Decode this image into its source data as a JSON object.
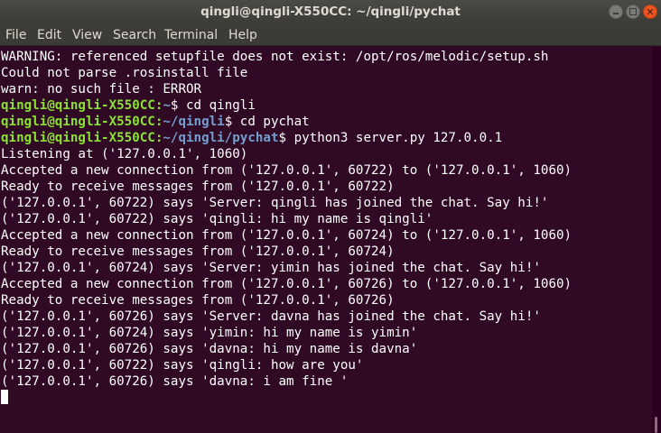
{
  "window": {
    "title": "qingli@qingli-X550CC: ~/qingli/pychat"
  },
  "menu": {
    "items": [
      "File",
      "Edit",
      "View",
      "Search",
      "Terminal",
      "Help"
    ]
  },
  "colors": {
    "background": "#300a24",
    "prompt_user": "#8ae234",
    "prompt_path": "#729fcf",
    "text": "#ffffff"
  },
  "terminal": {
    "lines": [
      {
        "type": "text",
        "text": "WARNING: referenced setupfile does not exist: /opt/ros/melodic/setup.sh"
      },
      {
        "type": "text",
        "text": "Could not parse .rosinstall file"
      },
      {
        "type": "text",
        "text": "warn: no such file : ERROR"
      },
      {
        "type": "prompt",
        "user": "qingli@qingli-X550CC:",
        "path": "~",
        "cmd": "$ cd qingli"
      },
      {
        "type": "prompt",
        "user": "qingli@qingli-X550CC:",
        "path": "~/qingli",
        "cmd": "$ cd pychat"
      },
      {
        "type": "prompt",
        "user": "qingli@qingli-X550CC:",
        "path": "~/qingli/pychat",
        "cmd": "$ python3 server.py 127.0.0.1"
      },
      {
        "type": "text",
        "text": "Listening at ('127.0.0.1', 1060)"
      },
      {
        "type": "text",
        "text": "Accepted a new connection from ('127.0.0.1', 60722) to ('127.0.0.1', 1060)"
      },
      {
        "type": "text",
        "text": "Ready to receive messages from ('127.0.0.1', 60722)"
      },
      {
        "type": "text",
        "text": "('127.0.0.1', 60722) says 'Server: qingli has joined the chat. Say hi!'"
      },
      {
        "type": "text",
        "text": "('127.0.0.1', 60722) says 'qingli: hi my name is qingli'"
      },
      {
        "type": "text",
        "text": "Accepted a new connection from ('127.0.0.1', 60724) to ('127.0.0.1', 1060)"
      },
      {
        "type": "text",
        "text": "Ready to receive messages from ('127.0.0.1', 60724)"
      },
      {
        "type": "text",
        "text": "('127.0.0.1', 60724) says 'Server: yimin has joined the chat. Say hi!'"
      },
      {
        "type": "text",
        "text": "Accepted a new connection from ('127.0.0.1', 60726) to ('127.0.0.1', 1060)"
      },
      {
        "type": "text",
        "text": "Ready to receive messages from ('127.0.0.1', 60726)"
      },
      {
        "type": "text",
        "text": "('127.0.0.1', 60726) says 'Server: davna has joined the chat. Say hi!'"
      },
      {
        "type": "text",
        "text": "('127.0.0.1', 60724) says 'yimin: hi my name is yimin'"
      },
      {
        "type": "text",
        "text": "('127.0.0.1', 60726) says 'davna: hi my name is davna'"
      },
      {
        "type": "text",
        "text": "('127.0.0.1', 60722) says 'qingli: how are you'"
      },
      {
        "type": "text",
        "text": "('127.0.0.1', 60726) says 'davna: i am fine '"
      },
      {
        "type": "cursor",
        "text": ""
      }
    ]
  }
}
